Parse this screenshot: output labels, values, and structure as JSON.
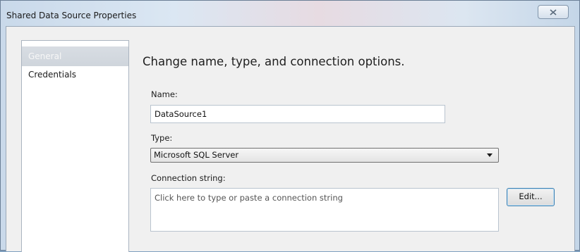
{
  "window": {
    "title": "Shared Data Source Properties"
  },
  "nav": {
    "items": [
      {
        "label": "General",
        "selected": true
      },
      {
        "label": "Credentials",
        "selected": false
      }
    ]
  },
  "main": {
    "heading": "Change name, type, and connection options.",
    "name_label": "Name:",
    "name_value": "DataSource1",
    "type_label": "Type:",
    "type_value": "Microsoft SQL Server",
    "connection_label": "Connection string:",
    "connection_placeholder": "Click here to type or paste a connection string",
    "edit_label": "Edit..."
  },
  "icons": {
    "close": "close-icon",
    "dropdown": "chevron-down-icon"
  }
}
